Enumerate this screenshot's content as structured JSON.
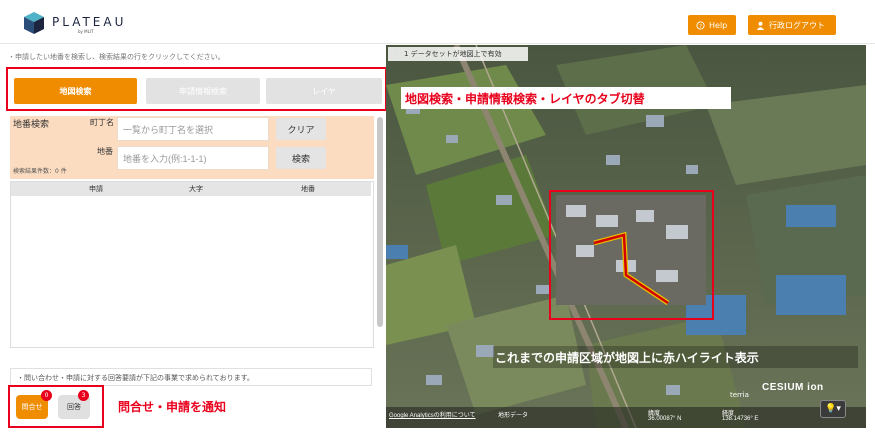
{
  "header": {
    "logo_text": "PLATEAU",
    "logo_sub": "by MLIT",
    "help_label": "Help",
    "logout_label": "行政ログアウト"
  },
  "left_panel": {
    "instruction": "・申請したい地番を検索し、検索結果の行をクリックしてください。",
    "tabs": [
      {
        "label": "地図検索",
        "active": true
      },
      {
        "label": "申請情報検索",
        "active": false
      },
      {
        "label": "レイヤ",
        "active": false
      }
    ],
    "search": {
      "title": "地番検索",
      "town_label": "町丁名",
      "town_placeholder": "一覧から町丁名を選択",
      "clear_label": "クリア",
      "chiban_label": "地番",
      "chiban_placeholder": "地番を入力(例:1-1-1)",
      "search_label": "検索",
      "result_count": "検索結果件数：0 件"
    },
    "results_table": {
      "columns": [
        "申請",
        "大字",
        "地番"
      ],
      "rows": []
    },
    "note": "・問い合わせ・申請に対する回答要請が下記の事業で求められております。",
    "inquiry": {
      "label": "問合せ",
      "badge": "0"
    },
    "answer": {
      "label": "回答",
      "badge": "3"
    }
  },
  "map": {
    "status": "1 データセットが地図上で有効",
    "footer": {
      "ga_link": "Google Analyticsの利用について",
      "map_data": "地形データ",
      "lat_label": "緯度",
      "lat_value": "36.00087° N",
      "lon_label": "経度",
      "lon_value": "138.14736° E"
    },
    "terria_logo": "terria",
    "cesium_logo": "CESIUM ion",
    "bulb_label": "💡▾"
  },
  "annotations": {
    "tabs": "地図検索・申請情報検索・レイヤのタブ切替",
    "highlight": "これまでの申請区域が地図上に赤ハイライト表示",
    "notify": "問合せ・申請を通知"
  },
  "colors": {
    "accent": "#f08c00",
    "annotation_red": "#e8001c",
    "panel_peach": "#fcdcc0"
  }
}
